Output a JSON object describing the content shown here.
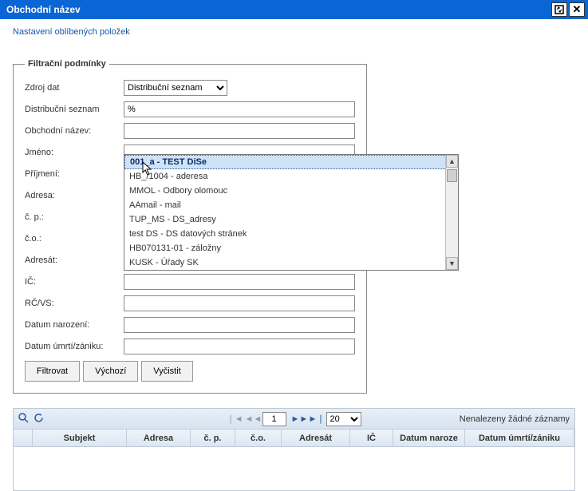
{
  "window": {
    "title": "Obchodní název"
  },
  "links": {
    "favorites": "Nastavení oblíbených položek"
  },
  "filters": {
    "legend": "Filtrační podmínky",
    "labels": {
      "data_source": "Zdroj dat",
      "dist_list": "Distribuční seznam",
      "trade_name": "Obchodní název:",
      "first_name": "Jméno:",
      "surname": "Příjmení:",
      "address": "Adresa:",
      "house_no": "č. p.:",
      "orient_no": "č.o.:",
      "addressee": "Adresát:",
      "ico": "IČ:",
      "rcvs": "RČ/VS:",
      "birth_date": "Datum narození:",
      "death_date": "Datum úmrtí/zániku:"
    },
    "values": {
      "data_source": "Distribuční seznam",
      "dist_list": "%",
      "trade_name": "",
      "first_name": "",
      "surname": "",
      "address": "",
      "house_no": "",
      "orient_no": "",
      "addressee": "",
      "ico": "",
      "rcvs": "",
      "birth_date": "",
      "death_date": ""
    },
    "buttons": {
      "filter": "Filtrovat",
      "default": "Výchozí",
      "clear": "Vyčistit"
    }
  },
  "dropdown": {
    "items": [
      "001_a - TEST DiSe",
      "HB_/1004 - aderesa",
      "MMOL - Odbory olomouc",
      "AAmail - mail",
      "TUP_MS - DS_adresy",
      "test DS - DS datových stránek",
      "HB070131-01 - záložny",
      "KUSK - Úřady SK"
    ]
  },
  "grid": {
    "pager": {
      "page": "1",
      "page_size": "20"
    },
    "status": "Nenalezeny žádné záznamy",
    "columns": {
      "subject": "Subjekt",
      "address": "Adresa",
      "house_no": "č. p.",
      "orient_no": "č.o.",
      "addressee": "Adresát",
      "ico": "IČ",
      "birth_date": "Datum naroze",
      "death_date": "Datum úmrtí/zániku"
    }
  }
}
